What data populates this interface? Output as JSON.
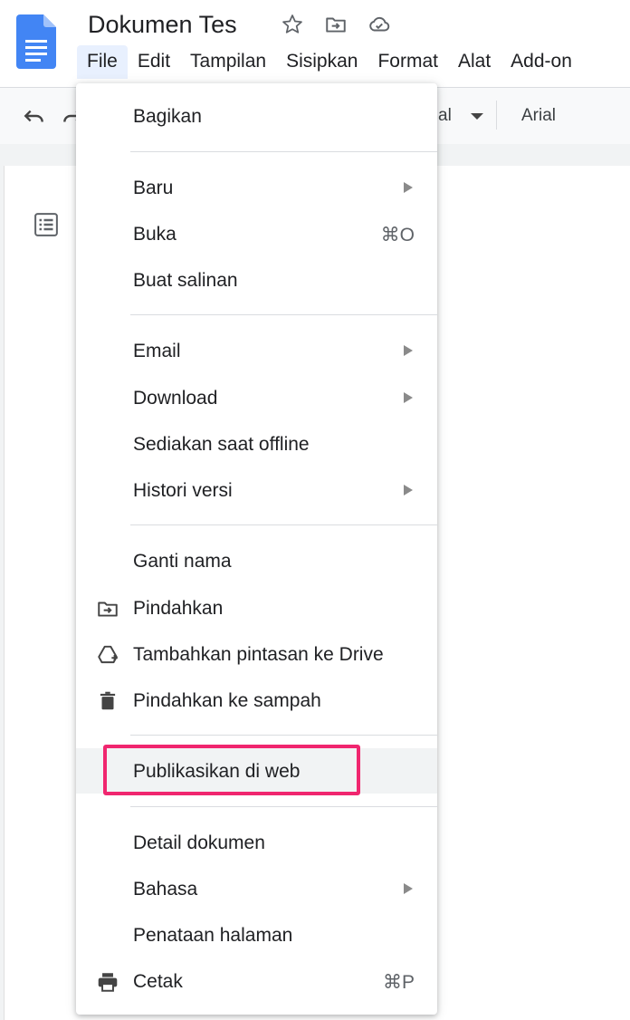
{
  "document": {
    "title": "Dokumen Tes"
  },
  "menubar": [
    "File",
    "Edit",
    "Tampilan",
    "Sisipkan",
    "Format",
    "Alat",
    "Add-on"
  ],
  "toolbar": {
    "font_partial": "al",
    "font": "Arial"
  },
  "file_menu": {
    "share": "Bagikan",
    "new": "Baru",
    "open": "Buka",
    "open_shortcut": "⌘O",
    "make_copy": "Buat salinan",
    "email": "Email",
    "download": "Download",
    "offline": "Sediakan saat offline",
    "version_history": "Histori versi",
    "rename": "Ganti nama",
    "move": "Pindahkan",
    "add_shortcut": "Tambahkan pintasan ke Drive",
    "trash": "Pindahkan ke sampah",
    "publish": "Publikasikan di web",
    "details": "Detail dokumen",
    "language": "Bahasa",
    "page_setup": "Penataan halaman",
    "print": "Cetak",
    "print_shortcut": "⌘P"
  },
  "colors": {
    "docs_blue": "#4285f4",
    "highlight_border": "#f0266f",
    "menu_active_bg": "#e8f0fe"
  },
  "icons": [
    "docs-logo",
    "star-icon",
    "move-to-folder-icon",
    "cloud-status-icon",
    "undo-icon",
    "redo-icon",
    "outline-icon",
    "folder-move-icon",
    "drive-shortcut-icon",
    "trash-icon",
    "printer-icon"
  ]
}
